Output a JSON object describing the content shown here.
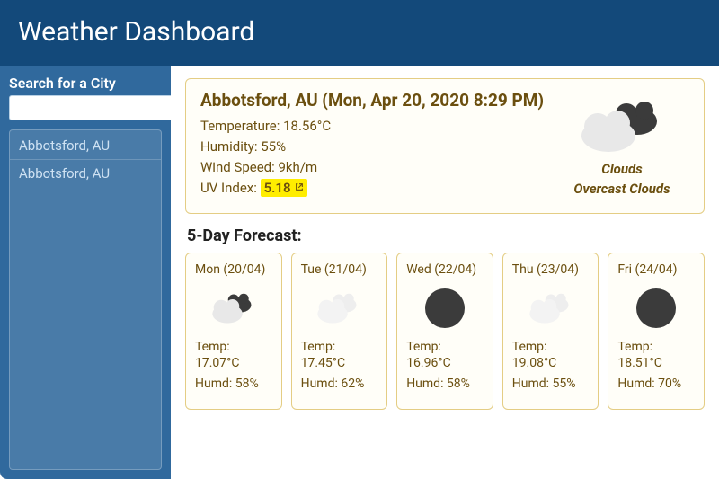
{
  "header": {
    "title": "Weather Dashboard"
  },
  "sidebar": {
    "search_label": "Search for a City",
    "search_placeholder": "",
    "history": [
      "Abbotsford, AU",
      "Abbotsford, AU"
    ]
  },
  "current": {
    "city_line": "Abbotsford, AU (Mon, Apr 20, 2020 8:29 PM)",
    "temperature_label": "Temperature: 18.56°C",
    "humidity_label": "Humidity: 55%",
    "wind_label": "Wind Speed: 9kh/m",
    "uv_prefix": "UV Index: ",
    "uv_value": "5.18",
    "condition_main": "Clouds",
    "condition_desc": "Overcast Clouds",
    "icon": "cloud-overcast"
  },
  "forecast_title": "5-Day Forecast:",
  "forecast": [
    {
      "date": "Mon (20/04)",
      "icon": "cloud-dark",
      "temp": "Temp: 17.07°C",
      "humd": "Humd: 58%"
    },
    {
      "date": "Tue (21/04)",
      "icon": "cloud-light",
      "temp": "Temp: 17.45°C",
      "humd": "Humd: 62%"
    },
    {
      "date": "Wed (22/04)",
      "icon": "sun-dark",
      "temp": "Temp: 16.96°C",
      "humd": "Humd: 58%"
    },
    {
      "date": "Thu (23/04)",
      "icon": "cloud-light",
      "temp": "Temp: 19.08°C",
      "humd": "Humd: 55%"
    },
    {
      "date": "Fri (24/04)",
      "icon": "sun-dark",
      "temp": "Temp: 18.51°C",
      "humd": "Humd: 70%"
    }
  ]
}
